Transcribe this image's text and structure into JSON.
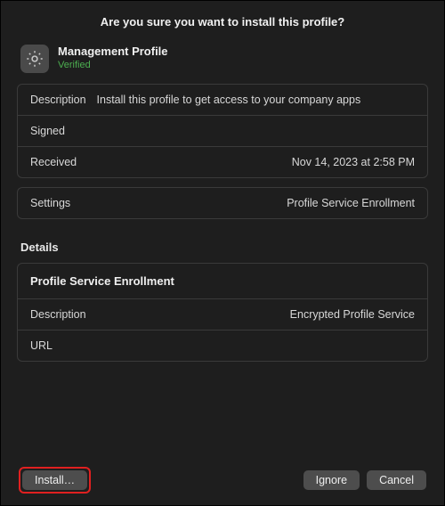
{
  "dialog": {
    "title": "Are you sure you want to install this profile?"
  },
  "profile": {
    "name": "Management Profile",
    "status": "Verified"
  },
  "info": {
    "description_label": "Description",
    "description_value": "Install this profile to get access to your company apps",
    "signed_label": "Signed",
    "signed_value": "",
    "received_label": "Received",
    "received_value": "Nov 14, 2023 at 2:58 PM"
  },
  "settings": {
    "label": "Settings",
    "value": "Profile Service Enrollment"
  },
  "details": {
    "heading": "Details",
    "panel_title": "Profile Service Enrollment",
    "description_label": "Description",
    "description_value": "Encrypted Profile Service",
    "url_label": "URL",
    "url_value": ""
  },
  "buttons": {
    "install": "Install…",
    "ignore": "Ignore",
    "cancel": "Cancel"
  }
}
